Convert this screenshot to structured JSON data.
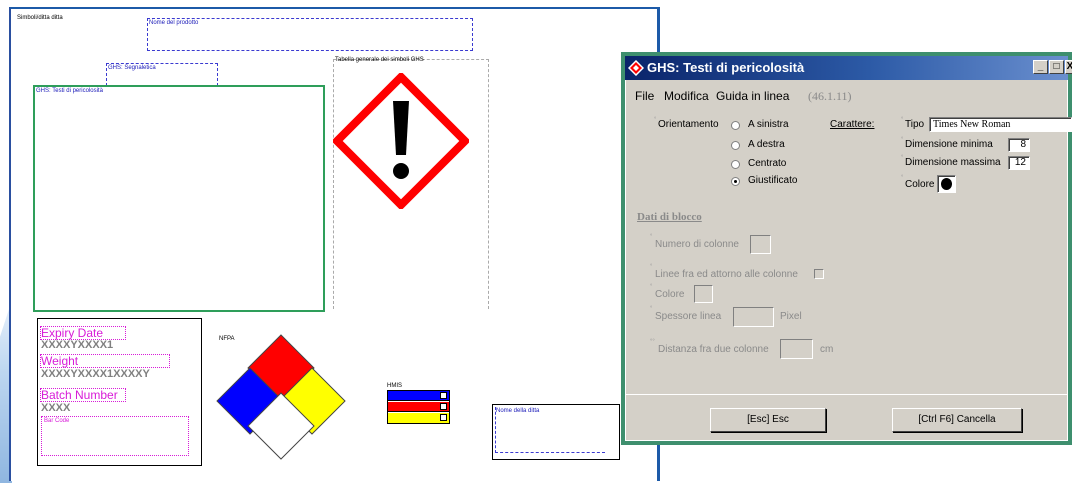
{
  "label": {
    "company_symbols": "Simboli/ditta ditta",
    "product_name": "Nome del prodotto",
    "ghs_signal": "GHS: Segnaletica",
    "ghs_table": "Tabella generale dei simboli GHS",
    "ghs_hazard_texts": "GHS: Testi di pericolosità",
    "nfpa": "NFPA",
    "hmis": "HMIS",
    "company_name": "Nome della ditta",
    "expiry_label": "Expiry Date",
    "expiry_value": "XXXXYXXXX1",
    "weight_label": "Weight",
    "weight_value": "XXXXYXXXX1XXXXY",
    "batch_label": "Batch Number",
    "batch_value": "XXXX",
    "barcode": "Bar Code"
  },
  "dialog": {
    "title": "GHS: Testi di pericolosità",
    "menu": {
      "file": "File",
      "modifica": "Modifica",
      "guida": "Guida in linea",
      "code": "(46.1.11)"
    },
    "orientation_label": "Orientamento",
    "orientation_options": [
      "A sinistra",
      "A destra",
      "Centrato",
      "Giustificato"
    ],
    "selected_orientation": "Giustificato",
    "font_section": "Carattere:",
    "type_label": "Tipo",
    "type_value": "Times New Roman",
    "min_size_label": "Dimensione minima",
    "min_size_value": "8",
    "max_size_label": "Dimensione massima",
    "max_size_value": "12",
    "color_label": "Colore",
    "block_section": "Dati di blocco",
    "columns_label": "Numero di colonne",
    "lines_label": "Linee fra ed attorno alle colonne",
    "block_color_label": "Colore",
    "line_width_label": "Spessore linea",
    "pixel_unit": "Pixel",
    "col_distance_label": "Distanza fra due colonne",
    "cm_unit": "cm",
    "esc_button": "[Esc] Esc",
    "cancel_button": "[Ctrl F6] Cancella",
    "window_buttons": [
      "_",
      "□",
      "X"
    ]
  },
  "colors": {
    "nfpa_red": "#ff0000",
    "nfpa_blue": "#0000ff",
    "nfpa_yellow": "#ffff00",
    "nfpa_white": "#ffffff",
    "ghs_red": "#ff0000",
    "label_magenta": "#d81bd8",
    "dialog_border": "#3e8f6e"
  }
}
